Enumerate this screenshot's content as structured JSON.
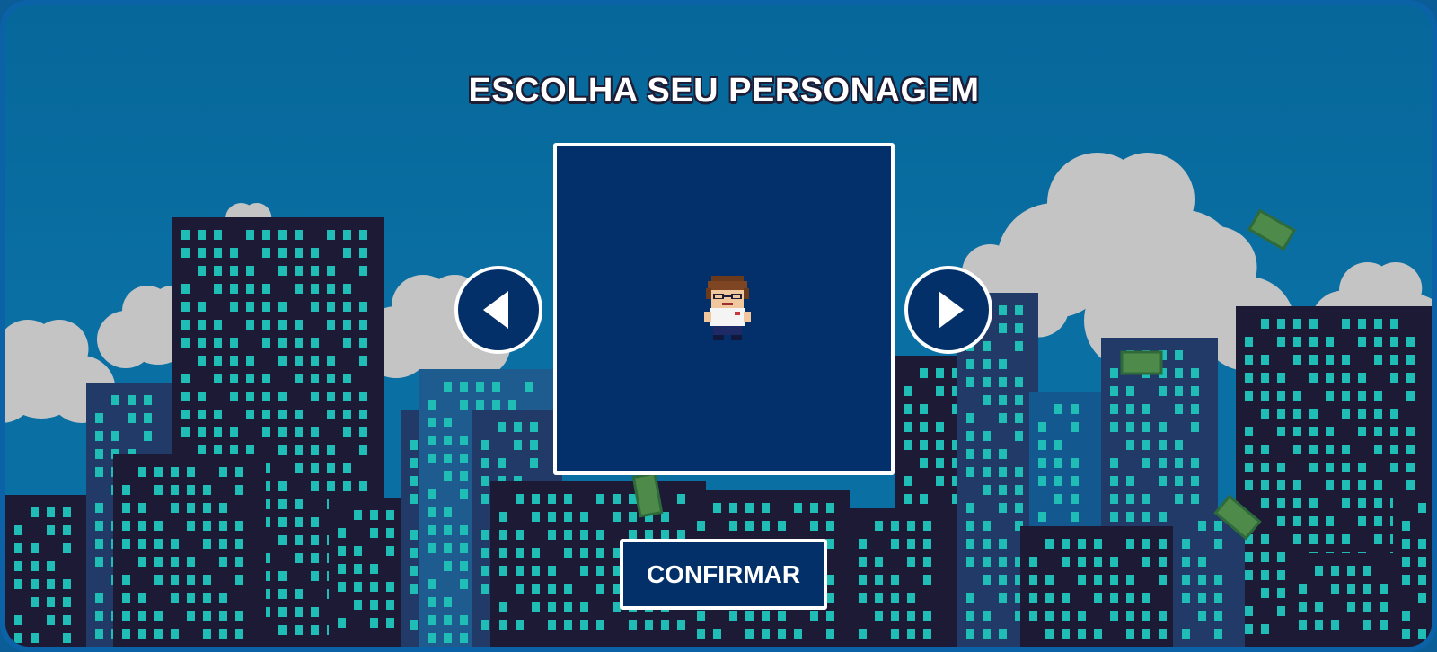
{
  "screen": {
    "title": "ESCOLHA SEU PERSONAGEM",
    "confirm_label": "CONFIRMAR"
  },
  "character_select": {
    "prev_icon": "triangle-left-icon",
    "next_icon": "triangle-right-icon",
    "current_character": "pixel-character-brown-hair"
  },
  "colors": {
    "sky": "#0a6fa3",
    "panel": "#03306a",
    "building_dark": "#1c1a35",
    "building_mid": "#213a68",
    "window": "#1fbdb5",
    "cloud": "#c4c4c4",
    "border": "#ffffff"
  }
}
